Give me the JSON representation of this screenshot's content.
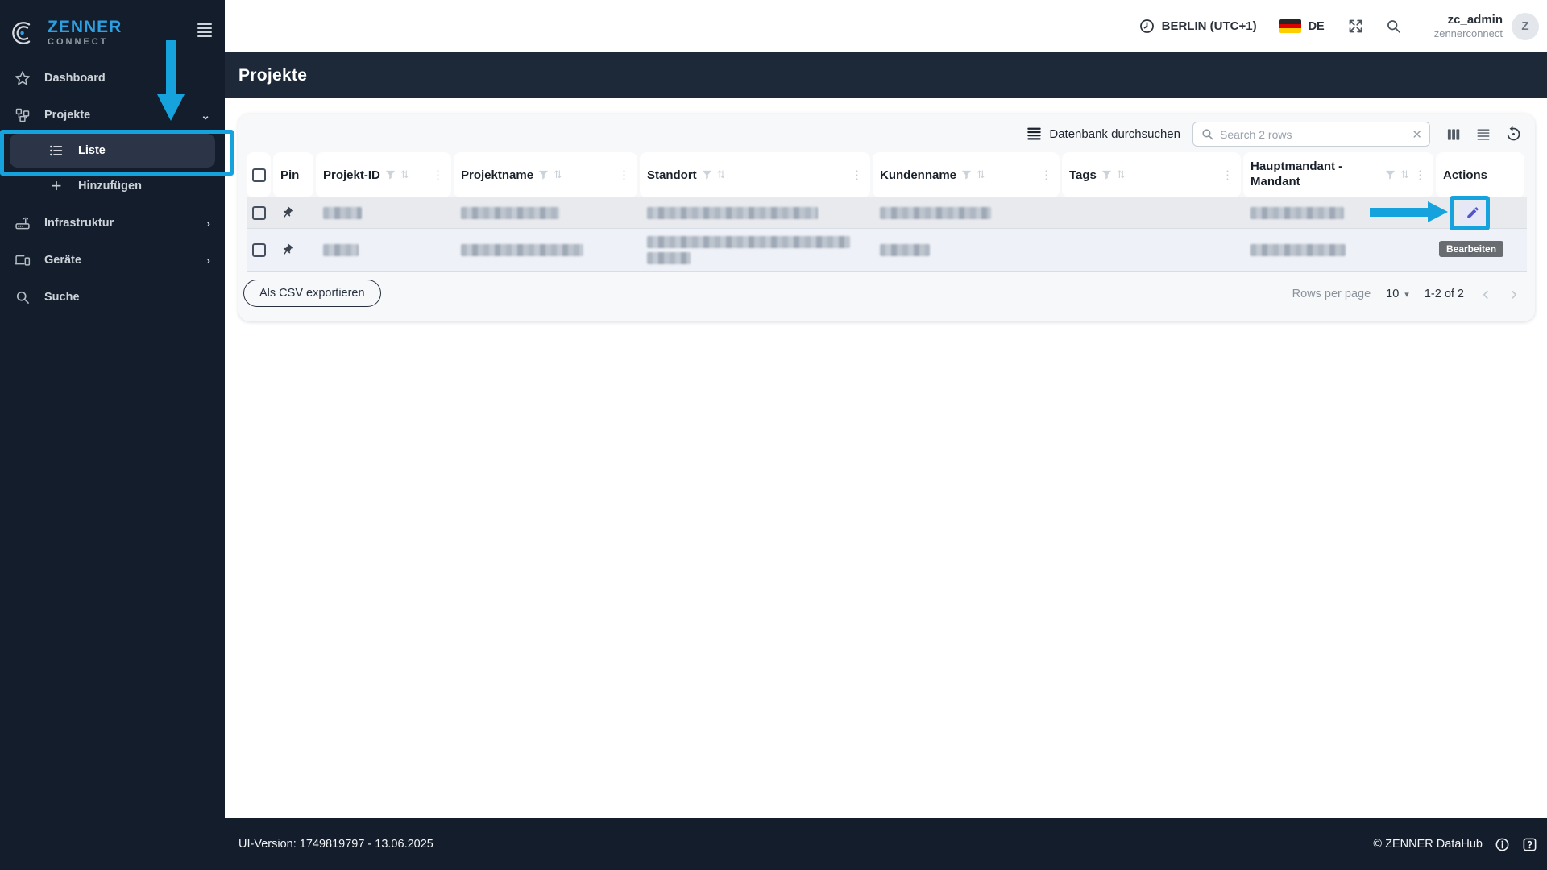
{
  "colors": {
    "annotation": "#16a2dc",
    "brand_blue": "#2e9fe0",
    "sidebar_bg": "#141d2b",
    "titlebar_bg": "#1d2939"
  },
  "sidebar": {
    "brand": "ZENNER",
    "brand_sub": "CONNECT",
    "items": {
      "dashboard": "Dashboard",
      "projekte": "Projekte",
      "liste": "Liste",
      "hinzufuegen": "Hinzufügen",
      "infrastruktur": "Infrastruktur",
      "geraete": "Geräte",
      "suche": "Suche"
    }
  },
  "topbar": {
    "timezone": "BERLIN (UTC+1)",
    "language": "DE",
    "username": "zc_admin",
    "tenant": "zennerconnect",
    "avatar_initial": "Z"
  },
  "page_title": "Projekte",
  "toolbar": {
    "database_search": "Datenbank durchsuchen",
    "search_placeholder": "Search 2 rows"
  },
  "columns": {
    "pin": "Pin",
    "projekt_id": "Projekt-ID",
    "projektname": "Projektname",
    "standort": "Standort",
    "kundenname": "Kundenname",
    "tags": "Tags",
    "hauptmandant": "Hauptmandant - Mandant",
    "actions": "Actions"
  },
  "table_note": {
    "row_count": 2,
    "rows_redacted": true
  },
  "actions_tooltip": "Bearbeiten",
  "export_csv": "Als CSV exportieren",
  "pagination": {
    "rows_per_page": "Rows per page",
    "value": "10",
    "range": "1-2 of 2"
  },
  "footer": {
    "version": "UI-Version: 1749819797 - 13.06.2025",
    "copyright": "© ZENNER DataHub"
  },
  "glyphs": {
    "kebab": "⋮",
    "sort": "⇅",
    "clear": "✕",
    "caret": "▾",
    "chev_left": "‹",
    "chev_right": "›",
    "chev_down": "⌄",
    "chev_sub": "›",
    "plus": "+"
  }
}
